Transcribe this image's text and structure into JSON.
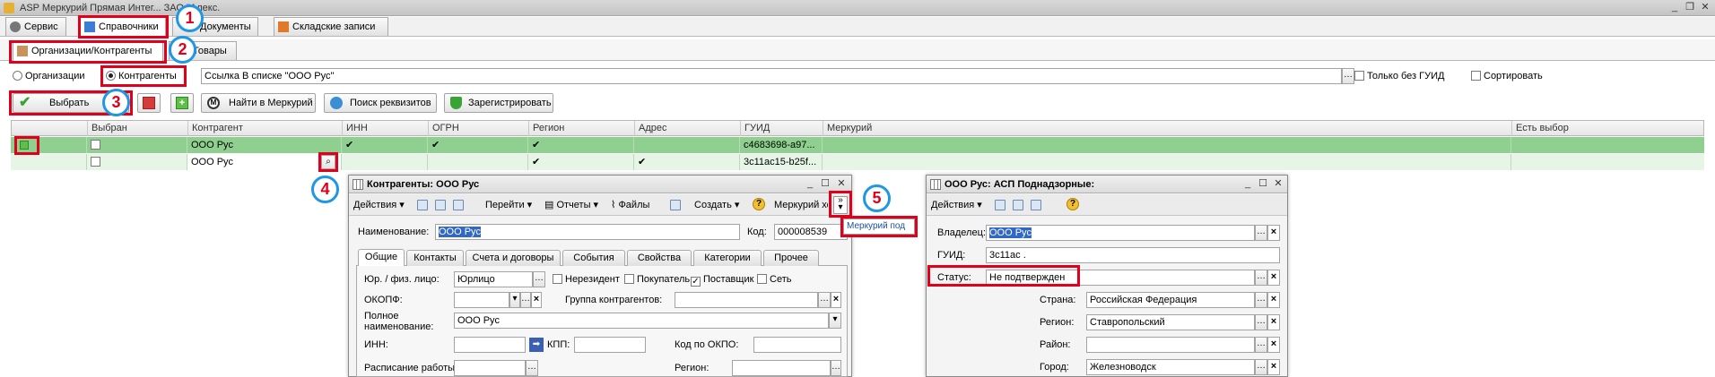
{
  "app": {
    "title": "ASP Меркурий Прямая Интег... ЗАО \"Алекс."
  },
  "main_tabs": [
    {
      "label": "Сервис"
    },
    {
      "label": "Справочники"
    },
    {
      "label": "Документы"
    },
    {
      "label": "Складские записи"
    }
  ],
  "sub_tabs": [
    {
      "label": "Организации/Контрагенты"
    },
    {
      "label": "Товары"
    }
  ],
  "filter": {
    "radio_org": "Организации",
    "radio_contr": "Контрагенты",
    "link_value": "Ссылка В списке \"ООО Рус\"",
    "only_no_guid": "Только без ГУИД",
    "sort": "Сортировать"
  },
  "toolbar": {
    "select": "Выбрать",
    "find_mercury": "Найти в Меркурий",
    "find_details": "Поиск реквизитов",
    "register": "Зарегистрировать"
  },
  "grid": {
    "columns": [
      "Выбран",
      "Контрагент",
      "ИНН",
      "ОГРН",
      "Регион",
      "Адрес",
      "ГУИД",
      "Меркурий",
      "Есть выбор"
    ],
    "rows": [
      {
        "contr": "ООО Рус",
        "guid": "c4683698-a97..."
      },
      {
        "contr": "ООО Рус",
        "guid": "3c11ac15-b25f..."
      }
    ]
  },
  "contr_window": {
    "title": "Контрагенты: ООО Рус",
    "toolbar": [
      "Действия",
      "Перейти",
      "Отчеты",
      "Файлы",
      "Создать",
      "Меркурий хоз"
    ],
    "name_label": "Наименование:",
    "name_value": "ООО Рус",
    "code_label": "Код:",
    "code_value": "000008539",
    "tabs": [
      "Общие",
      "Контакты",
      "Счета и договоры",
      "События",
      "Свойства",
      "Категории",
      "Прочее"
    ],
    "legal_label": "Юр. / физ. лицо:",
    "legal_value": "Юрлицо",
    "nonresident": "Нерезидент",
    "buyer": "Покупатель",
    "supplier": "Поставщик",
    "network": "Сеть",
    "okopf_label": "ОКОПФ:",
    "group_label": "Группа контрагентов:",
    "fullname_label": "Полное наименование:",
    "fullname_value": "ООО Рус",
    "inn_label": "ИНН:",
    "kpp_label": "КПП:",
    "okpo_label": "Код по ОКПО:",
    "schedule_label": "Расписание работы:",
    "region_label": "Регион:"
  },
  "mercury_popup": {
    "label": "Меркурий под"
  },
  "asp_window": {
    "title": "ООО Рус: АСП Поднадзорные:",
    "toolbar": [
      "Действия"
    ],
    "owner_label": "Владелец:",
    "owner_value": "ООО Рус",
    "guid_label": "ГУИД:",
    "guid_value": "3c11ac .",
    "status_label": "Статус:",
    "status_value": "Не подтвержден",
    "country_label": "Страна:",
    "country_value": "Российская Федерация",
    "region_label": "Регион:",
    "region_value": "Ставропольский",
    "district_label": "Район:",
    "district_value": "",
    "city_label": "Город:",
    "city_value": "Железноводск"
  },
  "badges": [
    "1",
    "2",
    "3",
    "4",
    "5"
  ],
  "colors": {
    "highlight": "#e0001b",
    "badge_ring": "#1f97e6",
    "row_selected": "#8fcf8f"
  }
}
